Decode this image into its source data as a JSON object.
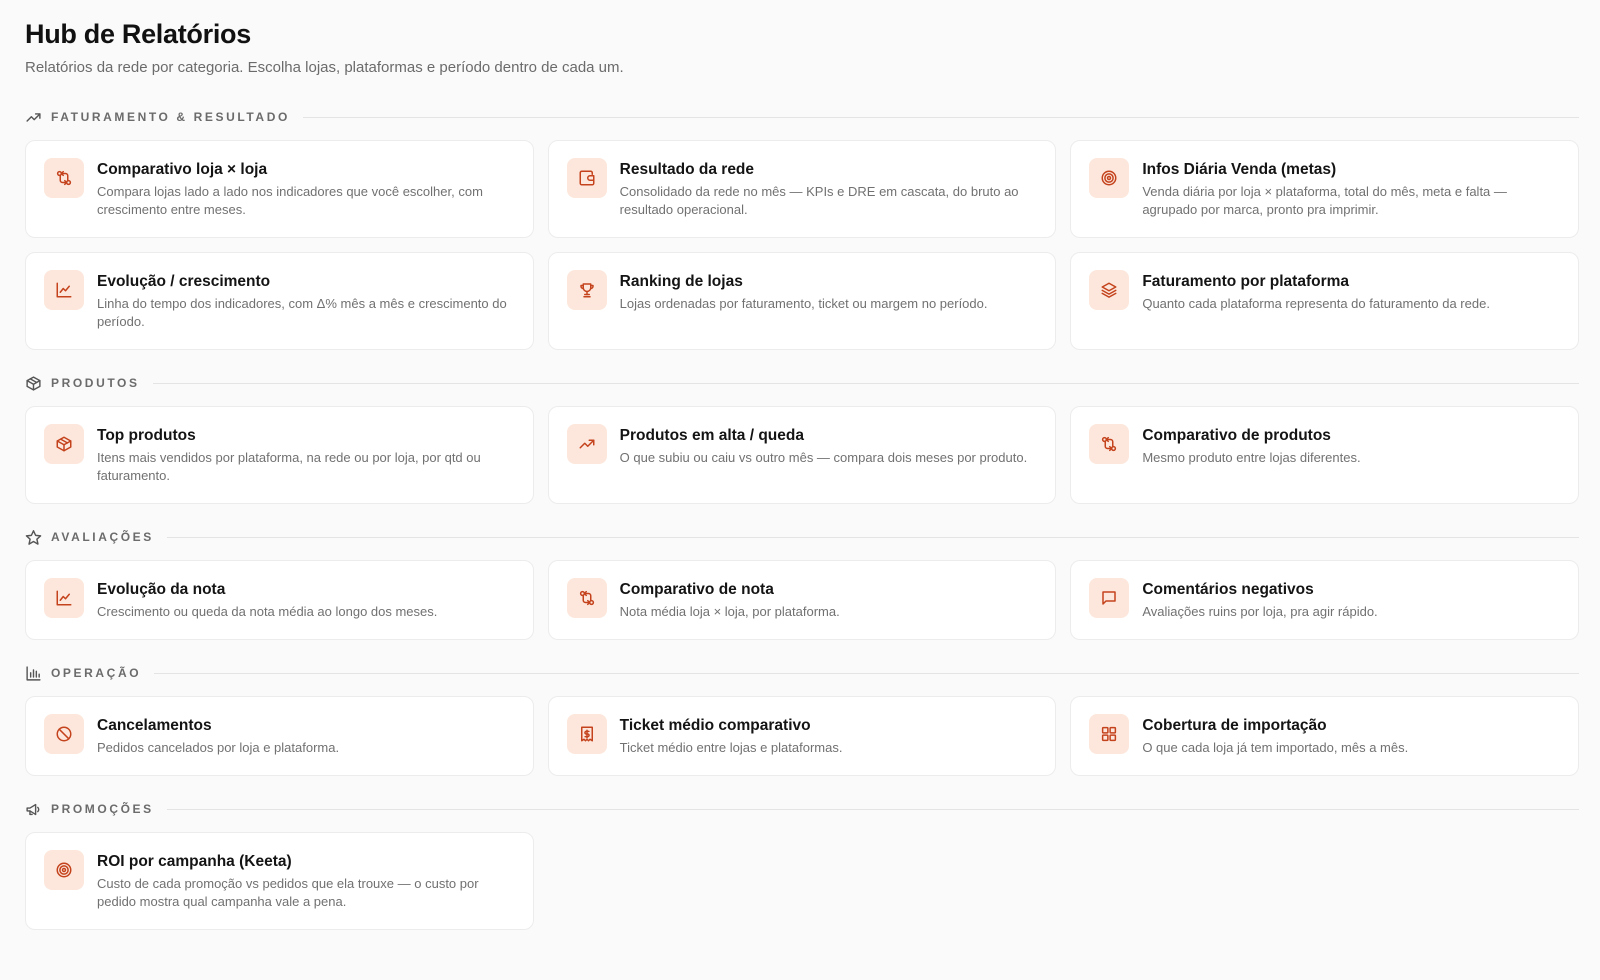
{
  "header": {
    "title": "Hub de Relatórios",
    "subtitle": "Relatórios da rede por categoria. Escolha lojas, plataformas e período dentro de cada um."
  },
  "accent_color": "#c4431d",
  "icon_bg_color": "#fde7dc",
  "sections": [
    {
      "label": "FATURAMENTO & RESULTADO",
      "icon": "trending-up-icon",
      "cards": [
        {
          "title": "Comparativo loja × loja",
          "desc": "Compara lojas lado a lado nos indicadores que você escolher, com crescimento entre meses.",
          "icon": "arrows-compare-icon"
        },
        {
          "title": "Resultado da rede",
          "desc": "Consolidado da rede no mês — KPIs e DRE em cascata, do bruto ao resultado operacional.",
          "icon": "wallet-icon"
        },
        {
          "title": "Infos Diária Venda (metas)",
          "desc": "Venda diária por loja × plataforma, total do mês, meta e falta — agrupado por marca, pronto pra imprimir.",
          "icon": "target-icon"
        },
        {
          "title": "Evolução / crescimento",
          "desc": "Linha do tempo dos indicadores, com Δ% mês a mês e crescimento do período.",
          "icon": "line-chart-icon"
        },
        {
          "title": "Ranking de lojas",
          "desc": "Lojas ordenadas por faturamento, ticket ou margem no período.",
          "icon": "trophy-icon"
        },
        {
          "title": "Faturamento por plataforma",
          "desc": "Quanto cada plataforma representa do faturamento da rede.",
          "icon": "layers-icon"
        }
      ]
    },
    {
      "label": "PRODUTOS",
      "icon": "box-icon",
      "cards": [
        {
          "title": "Top produtos",
          "desc": "Itens mais vendidos por plataforma, na rede ou por loja, por qtd ou faturamento.",
          "icon": "box-icon"
        },
        {
          "title": "Produtos em alta / queda",
          "desc": "O que subiu ou caiu vs outro mês — compara dois meses por produto.",
          "icon": "trending-up-icon"
        },
        {
          "title": "Comparativo de produtos",
          "desc": "Mesmo produto entre lojas diferentes.",
          "icon": "arrows-compare-icon"
        }
      ]
    },
    {
      "label": "AVALIAÇÕES",
      "icon": "star-icon",
      "cards": [
        {
          "title": "Evolução da nota",
          "desc": "Crescimento ou queda da nota média ao longo dos meses.",
          "icon": "line-chart-icon"
        },
        {
          "title": "Comparativo de nota",
          "desc": "Nota média loja × loja, por plataforma.",
          "icon": "arrows-compare-icon"
        },
        {
          "title": "Comentários negativos",
          "desc": "Avaliações ruins por loja, pra agir rápido.",
          "icon": "message-icon"
        }
      ]
    },
    {
      "label": "OPERAÇÃO",
      "icon": "bar-chart-icon",
      "cards": [
        {
          "title": "Cancelamentos",
          "desc": "Pedidos cancelados por loja e plataforma.",
          "icon": "ban-icon"
        },
        {
          "title": "Ticket médio comparativo",
          "desc": "Ticket médio entre lojas e plataformas.",
          "icon": "receipt-dollar-icon"
        },
        {
          "title": "Cobertura de importação",
          "desc": "O que cada loja já tem importado, mês a mês.",
          "icon": "grid-icon"
        }
      ]
    },
    {
      "label": "PROMOÇÕES",
      "icon": "megaphone-icon",
      "cards": [
        {
          "title": "ROI por campanha (Keeta)",
          "desc": "Custo de cada promoção vs pedidos que ela trouxe — o custo por pedido mostra qual campanha vale a pena.",
          "icon": "target-icon"
        }
      ]
    }
  ]
}
